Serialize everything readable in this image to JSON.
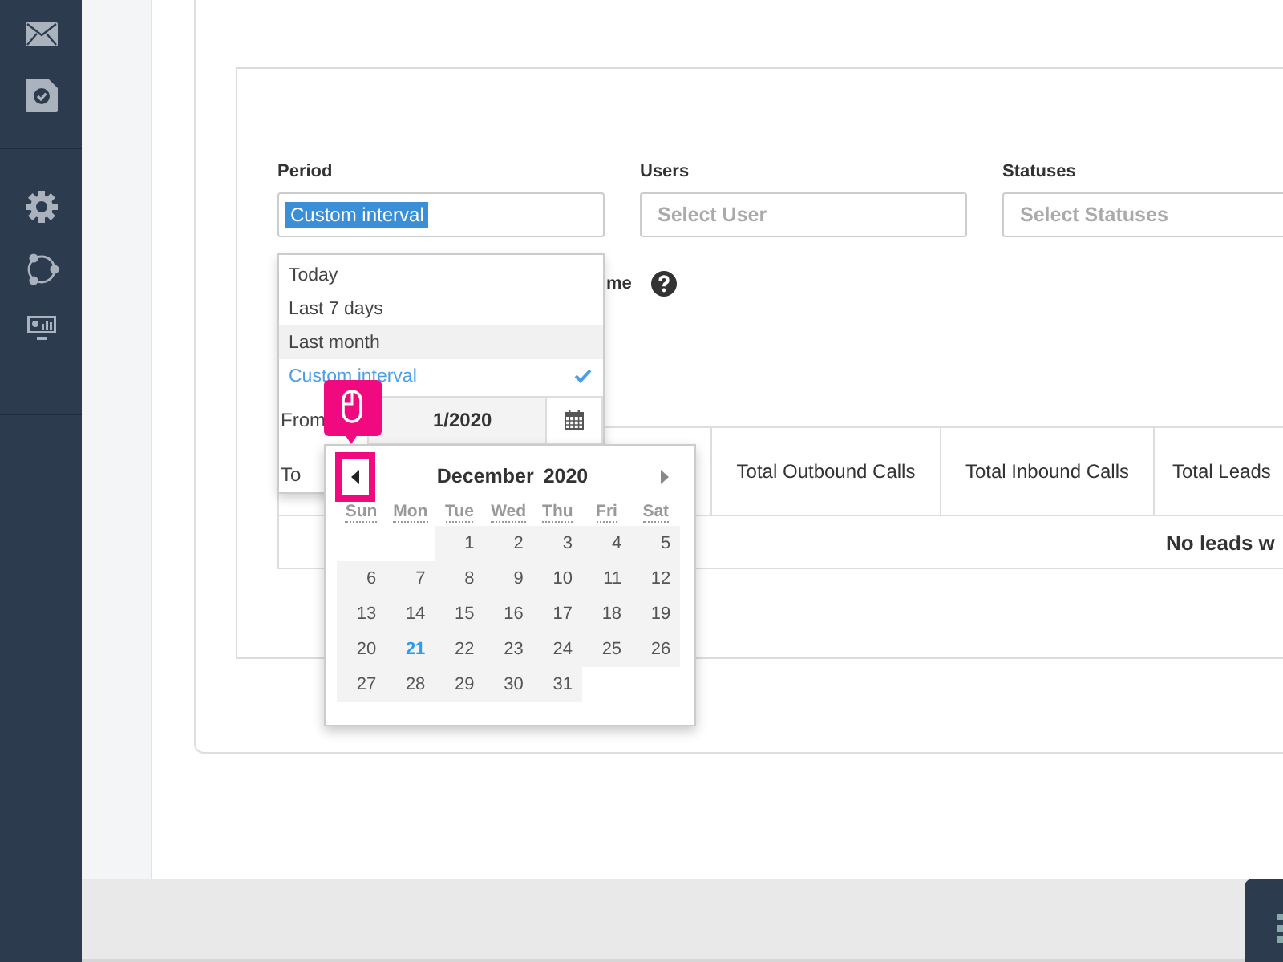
{
  "filters": [
    {
      "label": "Period",
      "value": "Custom interval",
      "text_selected": true
    },
    {
      "label": "Users",
      "placeholder": "Select User"
    },
    {
      "label": "Statuses",
      "placeholder": "Select Statuses"
    }
  ],
  "option_label": "me",
  "period_menu": {
    "options": [
      {
        "label": "Today",
        "selected": false,
        "hovered": false
      },
      {
        "label": "Last 7 days",
        "selected": false,
        "hovered": false
      },
      {
        "label": "Last month",
        "selected": false,
        "hovered": true
      },
      {
        "label": "Custom interval",
        "selected": true,
        "hovered": false
      }
    ],
    "from": {
      "label": "From",
      "value": "1/2020"
    },
    "to": {
      "label": "To"
    }
  },
  "calendar": {
    "month": "December",
    "year": "2020",
    "weekdays": [
      "Sun",
      "Mon",
      "Tue",
      "Wed",
      "Thu",
      "Fri",
      "Sat"
    ],
    "weeks": [
      [
        {
          "kind": "blank"
        },
        {
          "kind": "blank"
        },
        {
          "label": "1",
          "today": false
        },
        {
          "label": "2",
          "today": false
        },
        {
          "label": "3",
          "today": false
        },
        {
          "label": "4",
          "today": false
        },
        {
          "label": "5",
          "today": false
        }
      ],
      [
        {
          "label": "6",
          "today": false
        },
        {
          "label": "7",
          "today": false
        },
        {
          "label": "8",
          "today": false
        },
        {
          "label": "9",
          "today": false
        },
        {
          "label": "10",
          "today": false
        },
        {
          "label": "11",
          "today": false
        },
        {
          "label": "12",
          "today": false
        }
      ],
      [
        {
          "label": "13",
          "today": false
        },
        {
          "label": "14",
          "today": false
        },
        {
          "label": "15",
          "today": false
        },
        {
          "label": "16",
          "today": false
        },
        {
          "label": "17",
          "today": false
        },
        {
          "label": "18",
          "today": false
        },
        {
          "label": "19",
          "today": false
        }
      ],
      [
        {
          "label": "20",
          "today": false
        },
        {
          "label": "21",
          "today": true
        },
        {
          "label": "22",
          "today": false
        },
        {
          "label": "23",
          "today": false
        },
        {
          "label": "24",
          "today": false
        },
        {
          "label": "25",
          "today": false
        },
        {
          "label": "26",
          "today": false
        }
      ],
      [
        {
          "label": "27",
          "today": false
        },
        {
          "label": "28",
          "today": false
        },
        {
          "label": "29",
          "today": false
        },
        {
          "label": "30",
          "today": false
        },
        {
          "label": "31",
          "today": false
        },
        {
          "kind": "blank"
        },
        {
          "kind": "blank"
        }
      ]
    ]
  },
  "table": {
    "columns": [
      "Total Outbound Calls",
      "Total Inbound Calls",
      "Total Leads"
    ],
    "empty_message": "No leads w"
  }
}
